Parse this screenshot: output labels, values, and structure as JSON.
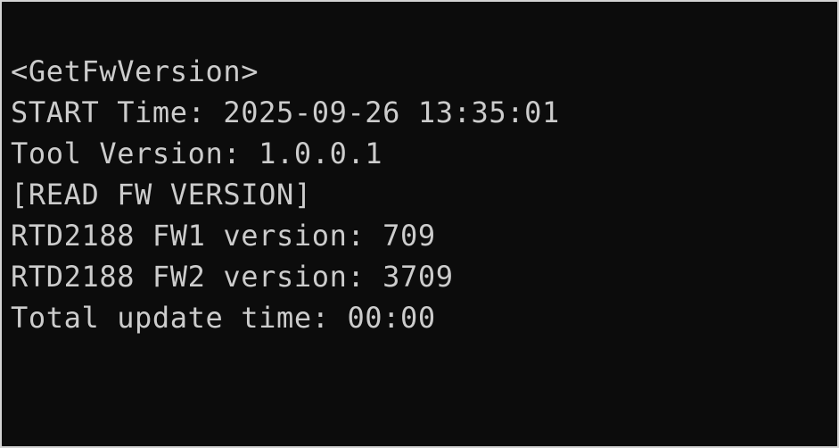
{
  "console": {
    "lines": [
      "<GetFwVersion>",
      "START Time: 2025-09-26 13:35:01",
      "Tool Version: 1.0.0.1",
      "[READ FW VERSION]",
      "RTD2188 FW1 version: 709",
      "RTD2188 FW2 version: 3709",
      "Total update time: 00:00"
    ]
  },
  "colors": {
    "background": "#0c0c0c",
    "text": "#cccccc",
    "border": "#d4d4d4"
  }
}
